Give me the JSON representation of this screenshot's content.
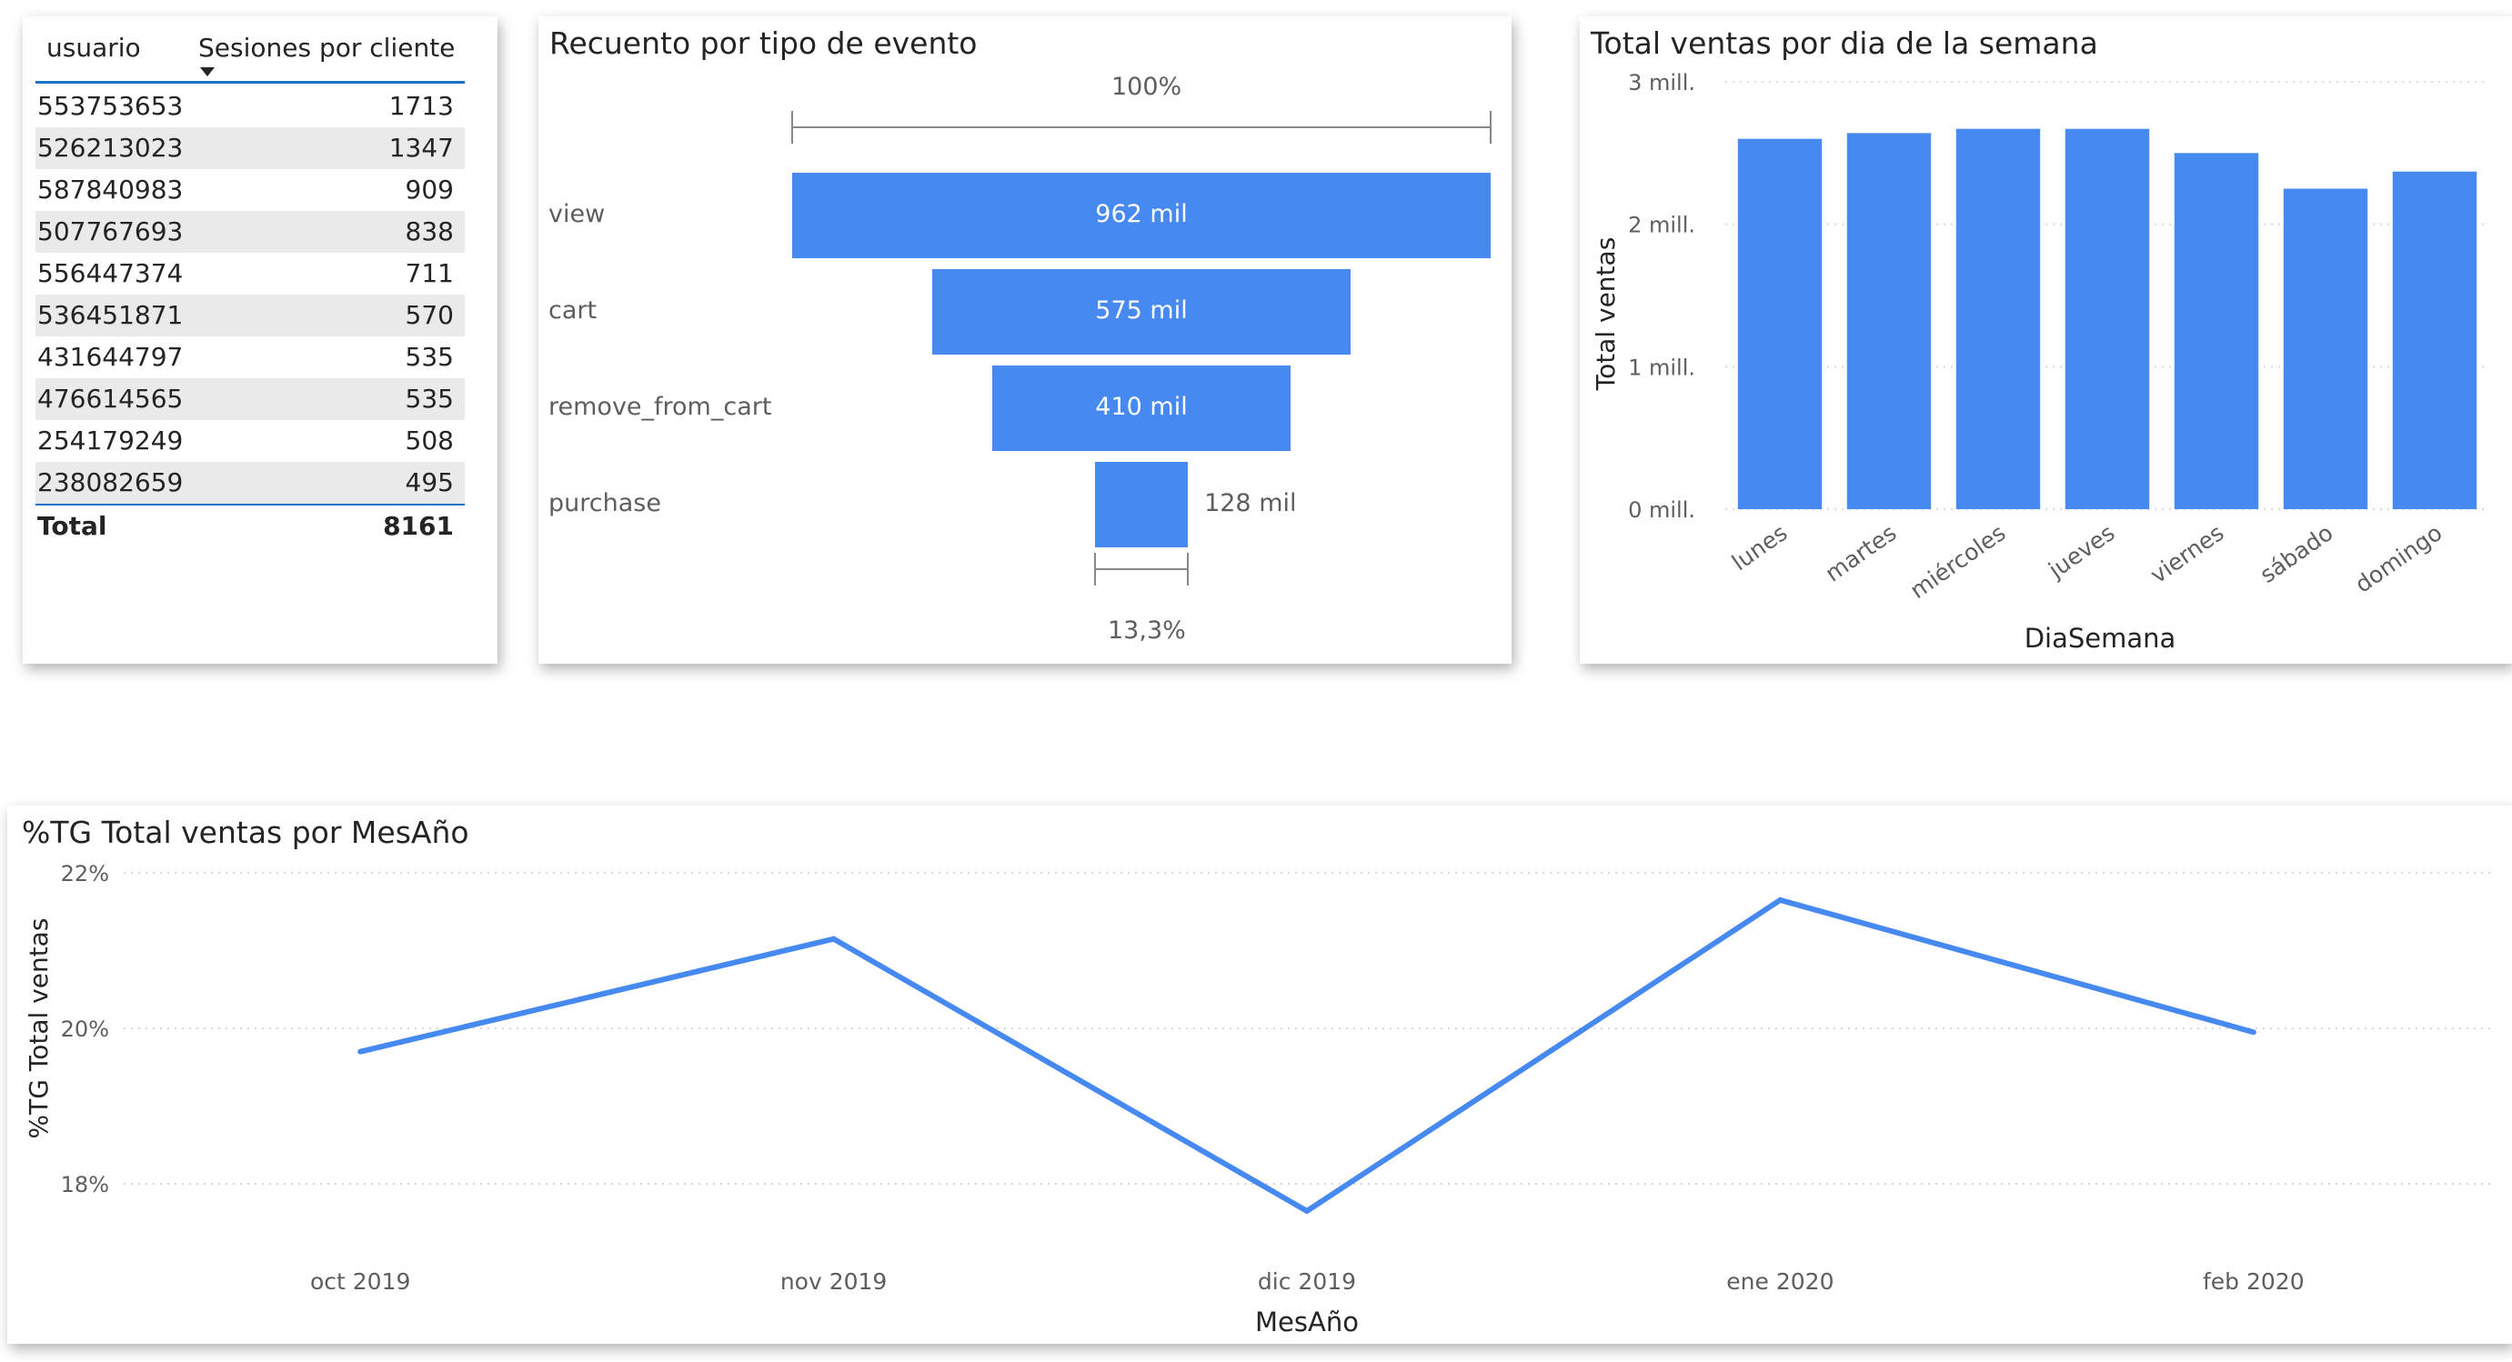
{
  "colors": {
    "accent": "#4589f1",
    "text": "#252423",
    "muted": "#605e5c",
    "row_alt": "#eaeaea",
    "header_rule": "#1b73c9"
  },
  "table": {
    "columns": [
      "usuario",
      "Sesiones por cliente"
    ],
    "sort_icon": "sort-descending-icon",
    "rows": [
      {
        "usuario": "553753653",
        "sesiones": "1713"
      },
      {
        "usuario": "526213023",
        "sesiones": "1347"
      },
      {
        "usuario": "587840983",
        "sesiones": "909"
      },
      {
        "usuario": "507767693",
        "sesiones": "838"
      },
      {
        "usuario": "556447374",
        "sesiones": "711"
      },
      {
        "usuario": "536451871",
        "sesiones": "570"
      },
      {
        "usuario": "431644797",
        "sesiones": "535"
      },
      {
        "usuario": "476614565",
        "sesiones": "535"
      },
      {
        "usuario": "254179249",
        "sesiones": "508"
      },
      {
        "usuario": "238082659",
        "sesiones": "495"
      }
    ],
    "total_label": "Total",
    "total_value": "8161"
  },
  "funnel": {
    "title": "Recuento por tipo de evento",
    "top_percent": "100%",
    "bottom_percent": "13,3%",
    "stages": [
      {
        "name": "view",
        "value": 962,
        "label": "962 mil"
      },
      {
        "name": "cart",
        "value": 575,
        "label": "575 mil"
      },
      {
        "name": "remove_from_cart",
        "value": 410,
        "label": "410 mil"
      },
      {
        "name": "purchase",
        "value": 128,
        "label": "128 mil"
      }
    ]
  },
  "bar_chart": {
    "title": "Total ventas por dia de la semana",
    "chart_data": {
      "type": "bar",
      "title": "Total ventas por dia de la semana",
      "xlabel": "DiaSemana",
      "ylabel": "Total ventas",
      "categories": [
        "lunes",
        "martes",
        "miércoles",
        "jueves",
        "viernes",
        "sábado",
        "domingo"
      ],
      "values": [
        2600000,
        2640000,
        2670000,
        2670000,
        2500000,
        2250000,
        2370000
      ],
      "ylim": [
        0,
        3000000
      ],
      "y_ticks": [
        {
          "value": 0,
          "label": "0 mill."
        },
        {
          "value": 1000000,
          "label": "1 mill."
        },
        {
          "value": 2000000,
          "label": "2 mill."
        },
        {
          "value": 3000000,
          "label": "3 mill."
        }
      ],
      "grid": true
    }
  },
  "line_chart": {
    "title": "%TG Total ventas por MesAño",
    "chart_data": {
      "type": "line",
      "title": "%TG Total ventas por MesAño",
      "xlabel": "MesAño",
      "ylabel": "%TG Total ventas",
      "categories": [
        "oct 2019",
        "nov 2019",
        "dic 2019",
        "ene 2020",
        "feb 2020"
      ],
      "values": [
        19.7,
        21.15,
        17.65,
        21.65,
        19.95
      ],
      "ylim": [
        17.6,
        22.0
      ],
      "y_ticks": [
        {
          "value": 18,
          "label": "18%"
        },
        {
          "value": 20,
          "label": "20%"
        },
        {
          "value": 22,
          "label": "22%"
        }
      ],
      "grid": true
    }
  }
}
